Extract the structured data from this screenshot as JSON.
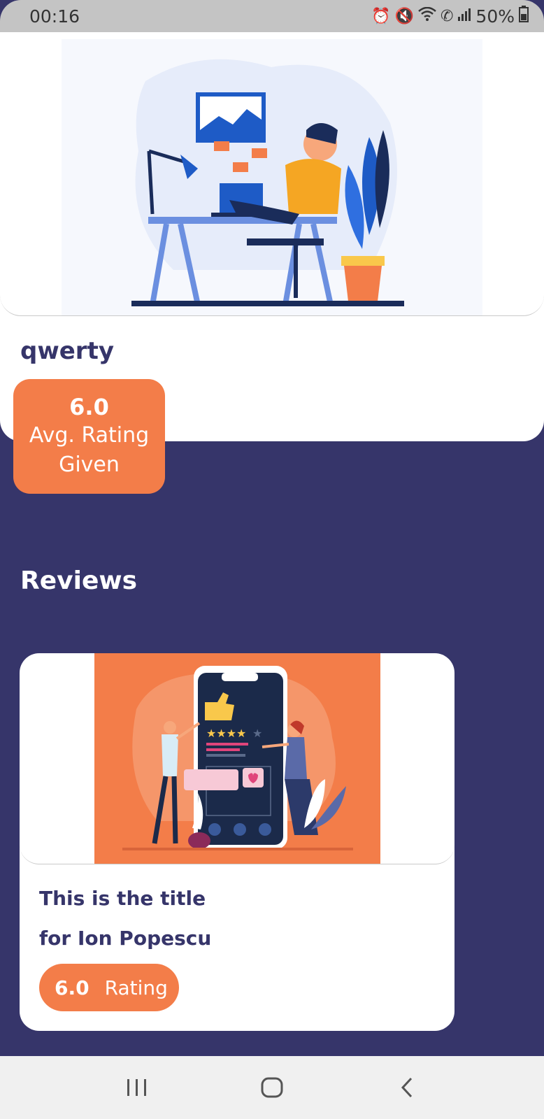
{
  "status_bar": {
    "time": "00:16",
    "battery": "50%",
    "icons": [
      "alarm-icon",
      "mute-icon",
      "wifi-icon",
      "call-icon",
      "signal-icon",
      "battery-icon"
    ]
  },
  "profile": {
    "name": "qwerty",
    "avg_rating": "6.0",
    "avg_rating_label_line1": "Avg. Rating",
    "avg_rating_label_line2": "Given"
  },
  "reviews": {
    "heading": "Reviews",
    "items": [
      {
        "title_line1": "This is the title",
        "title_line2": "for Ion Popescu",
        "rating": "6.0",
        "rating_label": "Rating"
      }
    ]
  },
  "nav": {
    "icons": [
      "recent-apps-icon",
      "home-icon",
      "back-icon"
    ]
  },
  "colors": {
    "background": "#36356a",
    "accent": "#f37d49",
    "text_dark": "#36356a",
    "card": "#ffffff"
  }
}
